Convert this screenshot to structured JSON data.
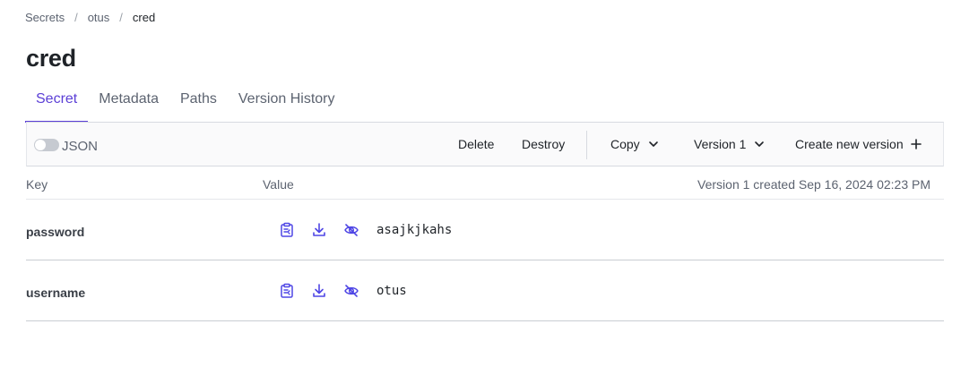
{
  "breadcrumb": {
    "items": [
      {
        "label": "Secrets"
      },
      {
        "label": "otus"
      },
      {
        "label": "cred"
      }
    ],
    "separator": "/"
  },
  "page": {
    "title": "cred"
  },
  "tabs": [
    {
      "label": "Secret",
      "active": true
    },
    {
      "label": "Metadata",
      "active": false
    },
    {
      "label": "Paths",
      "active": false
    },
    {
      "label": "Version History",
      "active": false
    }
  ],
  "toolbar": {
    "json_label": "JSON",
    "json_enabled": false,
    "delete_label": "Delete",
    "destroy_label": "Destroy",
    "copy_label": "Copy",
    "version_label": "Version 1",
    "create_label": "Create new version"
  },
  "table": {
    "key_header": "Key",
    "value_header": "Value",
    "created_info": "Version 1 created Sep 16, 2024 02:23 PM",
    "rows": [
      {
        "key": "password",
        "value": "asajkjkahs"
      },
      {
        "key": "username",
        "value": "otus"
      }
    ]
  },
  "colors": {
    "accent": "#5b3fd6",
    "icon": "#4f46e5",
    "muted": "#5c6370",
    "border": "#d7dae0"
  },
  "icons": {
    "copy": "clipboard-icon",
    "download": "download-icon",
    "visibility": "eye-off-icon"
  }
}
